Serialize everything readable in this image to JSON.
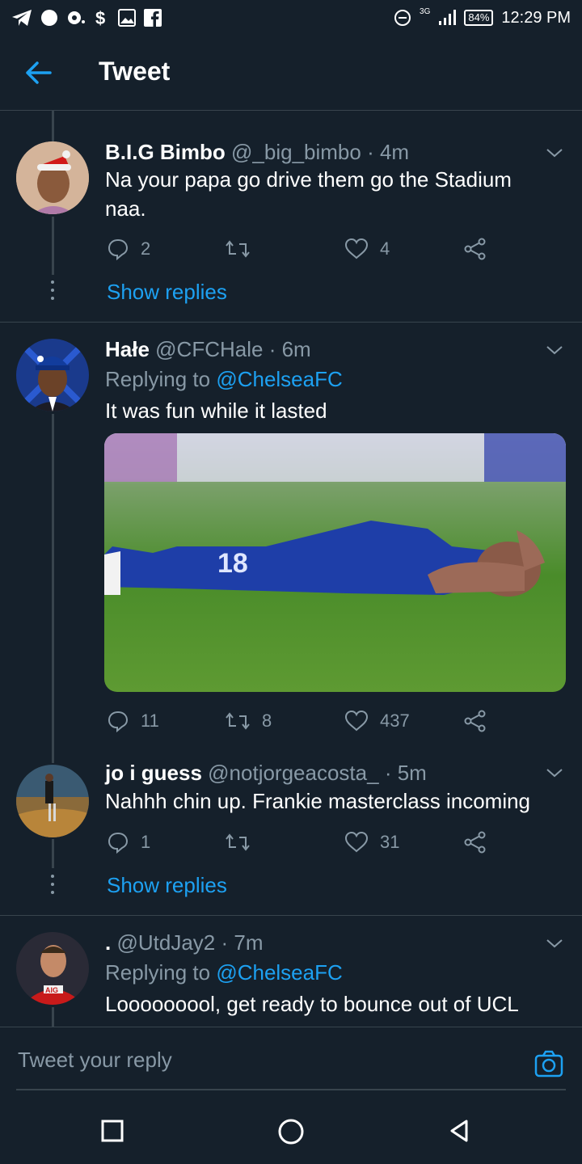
{
  "status_bar": {
    "network": "3G",
    "battery": "84%",
    "time": "12:29 PM"
  },
  "header": {
    "title": "Tweet"
  },
  "tweets": [
    {
      "name": "B.I.G Bimbo",
      "handle": "@_big_bimbo",
      "time": "· 4m",
      "text": "Na your papa go drive them go the Stadium naa.",
      "replies": "2",
      "retweets": "",
      "likes": "4",
      "show_replies": "Show replies"
    },
    {
      "name": "Hałe",
      "handle": "@CFCHale",
      "time": "· 6m",
      "replying_prefix": "Replying to",
      "replying_to": "@ChelseaFC",
      "text": "It was fun while it lasted",
      "replies": "11",
      "retweets": "8",
      "likes": "437"
    },
    {
      "name": "jo i guess",
      "handle": "@notjorgeacosta_",
      "time": "· 5m",
      "text": "Nahhh chin up. Frankie masterclass incoming",
      "replies": "1",
      "retweets": "",
      "likes": "31",
      "show_replies": "Show replies"
    },
    {
      "name": ".",
      "handle": "@UtdJay2",
      "time": "· 7m",
      "replying_prefix": "Replying to",
      "replying_to": "@ChelseaFC",
      "text": "Looooooool, get ready to bounce out of UCL"
    }
  ],
  "compose": {
    "placeholder": "Tweet your reply"
  },
  "colors": {
    "background": "#15202b",
    "accent": "#1da1f2",
    "muted": "#8899a6",
    "border": "#38444d"
  }
}
